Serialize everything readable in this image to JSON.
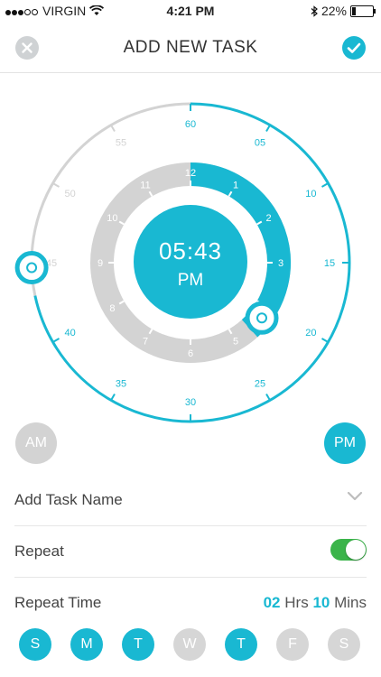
{
  "status_bar": {
    "carrier": "VIRGIN",
    "time": "4:21 PM",
    "battery": "22%"
  },
  "header": {
    "title": "ADD NEW TASK",
    "close_icon": "close-x-icon",
    "confirm_icon": "check-icon"
  },
  "dial": {
    "center_time": "05:43",
    "center_period": "PM",
    "minute_labels": [
      "60",
      "05",
      "10",
      "15",
      "20",
      "25",
      "30",
      "35",
      "40",
      "45",
      "50",
      "55"
    ],
    "hour_labels": [
      "12",
      "1",
      "2",
      "3",
      "4",
      "5",
      "6",
      "7",
      "8",
      "9",
      "10",
      "11"
    ],
    "active_minutes": [
      0,
      43
    ],
    "active_hours": [
      0,
      5
    ],
    "accent_color": "#19b8d2",
    "inactive_color": "#d3d3d3"
  },
  "period_buttons": {
    "am": "AM",
    "pm": "PM",
    "selected": "PM"
  },
  "form": {
    "task_name_label": "Add Task Name",
    "repeat_label": "Repeat",
    "repeat_on": true,
    "repeat_time_label": "Repeat Time",
    "repeat_hours": "02",
    "hours_unit": "Hrs",
    "repeat_minutes": "10",
    "minutes_unit": "Mins"
  },
  "days": [
    {
      "label": "S",
      "active": true
    },
    {
      "label": "M",
      "active": true
    },
    {
      "label": "T",
      "active": true
    },
    {
      "label": "W",
      "active": false
    },
    {
      "label": "T",
      "active": true
    },
    {
      "label": "F",
      "active": false
    },
    {
      "label": "S",
      "active": false
    }
  ]
}
